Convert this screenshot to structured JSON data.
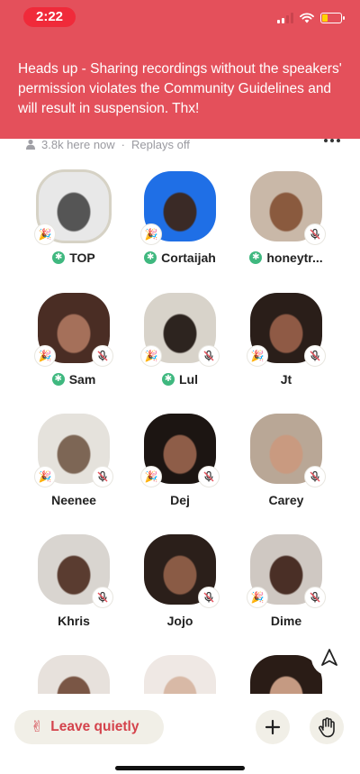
{
  "status_bar": {
    "time": "2:22",
    "icons": [
      "cellular-signal-icon",
      "wifi-icon",
      "battery-icon"
    ],
    "battery_level": 0.3,
    "signal_bars": [
      1,
      1,
      0,
      0
    ]
  },
  "banner": {
    "text": "Heads up - Sharing recordings without the speakers' permission violates the Community Guidelines and will result in suspension. Thx!",
    "color": "#e4505b"
  },
  "room_info": {
    "listeners": "3.8k here now",
    "separator": "·",
    "replays": "Replays off"
  },
  "speakers": [
    {
      "name": "TOP",
      "moderator": true,
      "tada": true,
      "muted": false,
      "ring": true,
      "colors": [
        "#e8e8e8",
        "#555"
      ]
    },
    {
      "name": "Cortaijah",
      "moderator": true,
      "tada": true,
      "muted": false,
      "ring": false,
      "colors": [
        "#1f6fe6",
        "#3a2a26"
      ]
    },
    {
      "name": "honeytr...",
      "moderator": true,
      "tada": false,
      "muted": true,
      "ring": false,
      "colors": [
        "#c9b8a8",
        "#8a5a3e"
      ]
    },
    {
      "name": "Sam",
      "moderator": true,
      "tada": true,
      "muted": true,
      "ring": false,
      "colors": [
        "#4a2d24",
        "#a5705a"
      ]
    },
    {
      "name": "Lul",
      "moderator": true,
      "tada": true,
      "muted": true,
      "ring": false,
      "colors": [
        "#d8d3ca",
        "#2d241f"
      ]
    },
    {
      "name": "Jt",
      "moderator": false,
      "tada": true,
      "muted": true,
      "ring": false,
      "colors": [
        "#2a1e19",
        "#8f5a45"
      ]
    },
    {
      "name": "Neenee",
      "moderator": false,
      "tada": true,
      "muted": true,
      "ring": false,
      "colors": [
        "#e5e2dc",
        "#7d6655"
      ]
    },
    {
      "name": "Dej",
      "moderator": false,
      "tada": true,
      "muted": true,
      "ring": false,
      "colors": [
        "#1c1512",
        "#8e5d48"
      ]
    },
    {
      "name": "Carey",
      "moderator": false,
      "tada": false,
      "muted": true,
      "ring": false,
      "colors": [
        "#b9a796",
        "#c99a80"
      ]
    },
    {
      "name": "Khris",
      "moderator": false,
      "tada": false,
      "muted": true,
      "ring": false,
      "colors": [
        "#d9d5d0",
        "#5a3c30"
      ]
    },
    {
      "name": "Jojo",
      "moderator": false,
      "tada": false,
      "muted": true,
      "ring": false,
      "colors": [
        "#2b1f1a",
        "#8a5b45"
      ]
    },
    {
      "name": "Dime",
      "moderator": false,
      "tada": true,
      "muted": true,
      "ring": false,
      "colors": [
        "#cfc8c2",
        "#4a2f26"
      ]
    },
    {
      "name": "",
      "moderator": false,
      "tada": false,
      "muted": false,
      "ring": false,
      "colors": [
        "#e7e1dc",
        "#7a5645"
      ]
    },
    {
      "name": "",
      "moderator": false,
      "tada": false,
      "muted": false,
      "ring": false,
      "colors": [
        "#efe8e4",
        "#d8b9a6"
      ]
    },
    {
      "name": "",
      "moderator": false,
      "tada": false,
      "muted": false,
      "ring": false,
      "colors": [
        "#2a1c16",
        "#c59a82"
      ]
    }
  ],
  "bottom_bar": {
    "leave_label": "Leave quietly",
    "leave_icon": "peace-hand-icon",
    "add_icon": "plus-icon",
    "raise_hand_icon": "raise-hand-icon"
  },
  "nav": {
    "icon": "navigation-arrow-icon"
  }
}
